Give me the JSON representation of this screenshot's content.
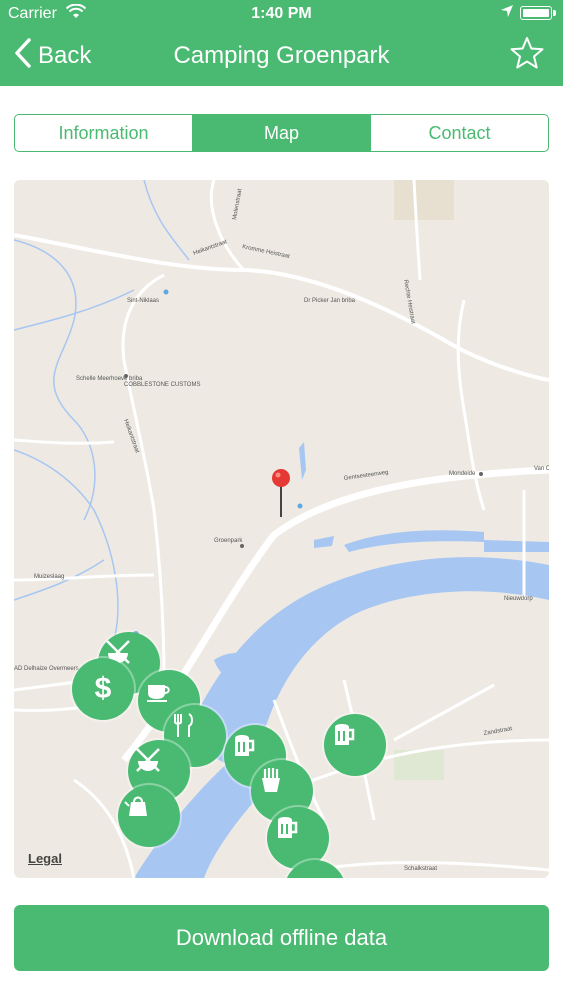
{
  "status_bar": {
    "carrier": "Carrier",
    "time": "1:40 PM"
  },
  "nav": {
    "back_label": "Back",
    "title": "Camping Groenpark"
  },
  "tabs": [
    {
      "label": "Information",
      "active": false
    },
    {
      "label": "Map",
      "active": true
    },
    {
      "label": "Contact",
      "active": false
    }
  ],
  "map": {
    "legal": "Legal",
    "street_labels": [
      "Heikantstraat",
      "Molenstraat",
      "Kromme Heistraat",
      "Rechte Heistraat",
      "Sint-Niklaas",
      "Dr Picker Jan briba",
      "Schelle Meerhoeve briba",
      "COBBLESTONE CUSTOMS",
      "Heikantstraat",
      "Gentsesteenweg",
      "Groenpark",
      "Mondeide",
      "Van Cl",
      "Muizeslaag",
      "AD Delhaize Overmeers",
      "Zandstraat",
      "Nieuwdorp",
      "Schalkstraat"
    ],
    "pois": [
      {
        "icon": "no-food-icon"
      },
      {
        "icon": "dollar-icon",
        "label": "$"
      },
      {
        "icon": "cafe-icon"
      },
      {
        "icon": "restaurant-icon"
      },
      {
        "icon": "no-food-icon"
      },
      {
        "icon": "kettle-icon"
      },
      {
        "icon": "beer-icon"
      },
      {
        "icon": "fries-icon"
      },
      {
        "icon": "beer-icon"
      },
      {
        "icon": "beer-icon"
      }
    ]
  },
  "download_button": "Download offline data",
  "colors": {
    "accent": "#4aba72",
    "map_background": "#eeeae3",
    "water": "#a7c6f2",
    "pin": "#e53935"
  }
}
